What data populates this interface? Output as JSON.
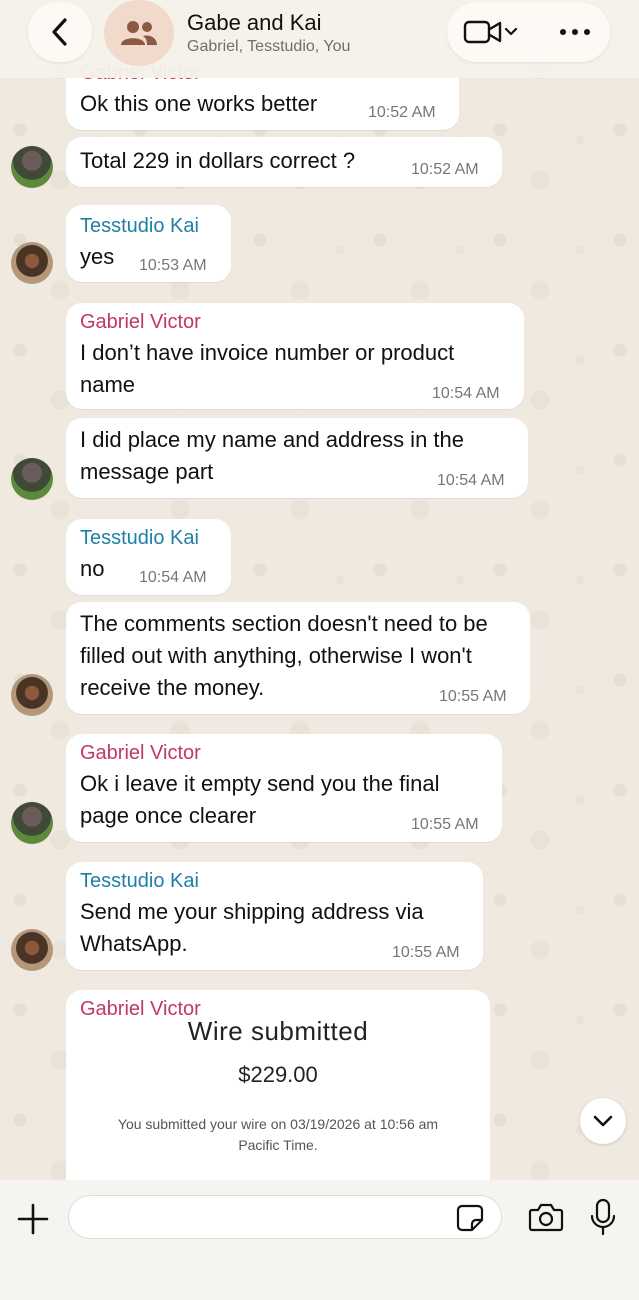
{
  "header": {
    "title": "Gabe and Kai",
    "subtitle": "Gabriel, Tesstudio, You"
  },
  "messages": [
    {
      "sender": "Gabriel Victor",
      "text": "Ok this one works better",
      "time": "10:52 AM"
    },
    {
      "text": "Total 229 in dollars correct ?",
      "time": "10:52 AM"
    },
    {
      "sender": "Tesstudio Kai",
      "text": "yes",
      "time": "10:53 AM"
    },
    {
      "sender": "Gabriel Victor",
      "text": "I don’t have invoice number or product name",
      "time": "10:54 AM"
    },
    {
      "text": "I did place my name and address in the message part",
      "time": "10:54 AM"
    },
    {
      "sender": "Tesstudio Kai",
      "text": "no",
      "time": "10:54 AM"
    },
    {
      "text": "The comments section doesn't need to be filled out with anything, otherwise I won't receive the money.",
      "time": "10:55 AM"
    },
    {
      "sender": "Gabriel Victor",
      "text": "Ok i leave it empty send you the final page once clearer",
      "time": "10:55 AM"
    },
    {
      "sender": "Tesstudio Kai",
      "text": "Send me your shipping address via WhatsApp.",
      "time": "10:55 AM"
    },
    {
      "sender": "Gabriel Victor"
    }
  ],
  "wire_card": {
    "title": "Wire submitted",
    "amount": "$229.00",
    "description": "You submitted your wire on 03/19/2026 at 10:56 am Pacific Time."
  },
  "composer": {
    "placeholder": ""
  },
  "colors": {
    "gabriel_name": "#c2366a",
    "kai_name": "#1f7fa6",
    "background": "#efe9df"
  },
  "icons": [
    "back-chevron-icon",
    "group-people-icon",
    "video-call-icon",
    "more-dots-icon",
    "chevron-down-icon",
    "plus-icon",
    "sticker-icon",
    "camera-icon",
    "microphone-icon"
  ]
}
